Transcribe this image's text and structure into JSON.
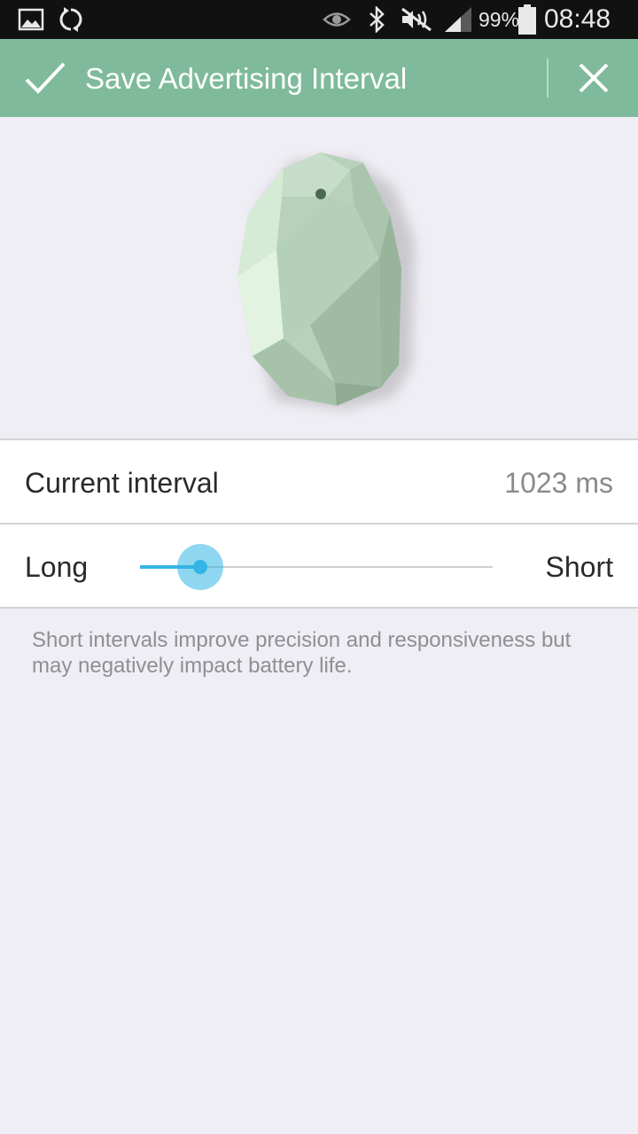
{
  "status_bar": {
    "icons": [
      "gallery-icon",
      "sync-icon",
      "eye-icon",
      "bluetooth-icon",
      "mute-icon",
      "signal-icon",
      "battery-icon"
    ],
    "battery": "99%",
    "time": "08:48"
  },
  "action_bar": {
    "title": "Save Advertising Interval",
    "confirm_icon": "check-icon",
    "close_icon": "close-icon",
    "color": "#7eba9b"
  },
  "current_interval": {
    "label": "Current interval",
    "value": "1023 ms"
  },
  "interval_slider": {
    "min_label": "Long",
    "max_label": "Short",
    "position": 0.17,
    "accent": "#33b5e5"
  },
  "hint": "Short intervals improve precision and responsiveness but may negatively impact battery life."
}
